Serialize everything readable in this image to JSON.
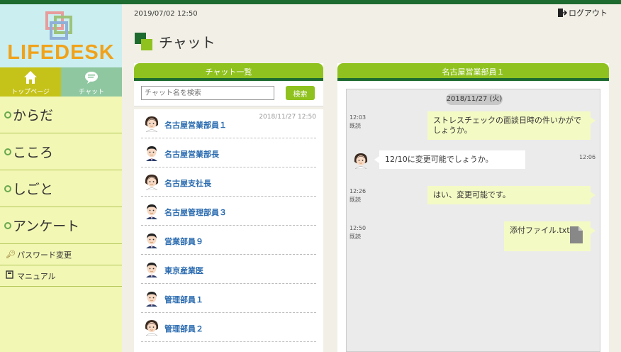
{
  "app": {
    "logo_text": "LIFEDESK",
    "datetime": "2019/07/02 12:50",
    "logout_label": "ログアウト",
    "page_title": "チャット",
    "colors": {
      "accent_green": "#8fc21e",
      "dark_green": "#1e6b30",
      "sidebar_bg": "#f2f7b4",
      "logo_bg": "#cbeef0",
      "link_blue": "#2a6bb0"
    }
  },
  "sidebar": {
    "tabs": [
      {
        "label": "トップページ",
        "icon": "home-icon"
      },
      {
        "label": "チャット",
        "icon": "chat-icon"
      }
    ],
    "menu": [
      {
        "label": "からだ"
      },
      {
        "label": "こころ"
      },
      {
        "label": "しごと"
      },
      {
        "label": "アンケート"
      }
    ],
    "sub": [
      {
        "label": "パスワード変更",
        "icon": "key-icon"
      },
      {
        "label": "マニュアル",
        "icon": "book-icon"
      }
    ]
  },
  "chat_list": {
    "header": "チャット一覧",
    "search_placeholder": "チャット名を検索",
    "search_button": "検索",
    "items": [
      {
        "name": "名古屋営業部員１",
        "timestamp": "2018/11/27 12:50",
        "avatar": "female"
      },
      {
        "name": "名古屋営業部長",
        "timestamp": "",
        "avatar": "male"
      },
      {
        "name": "名古屋支社長",
        "timestamp": "",
        "avatar": "female"
      },
      {
        "name": "名古屋管理部員３",
        "timestamp": "",
        "avatar": "male"
      },
      {
        "name": "営業部員９",
        "timestamp": "",
        "avatar": "male"
      },
      {
        "name": "東京産業医",
        "timestamp": "",
        "avatar": "male"
      },
      {
        "name": "管理部員１",
        "timestamp": "",
        "avatar": "male"
      },
      {
        "name": "管理部員２",
        "timestamp": "",
        "avatar": "female"
      }
    ]
  },
  "chat_detail": {
    "header": "名古屋営業部員１",
    "date_chip": "2018/11/27 (火)",
    "messages": [
      {
        "side": "me",
        "time": "12:03",
        "status": "既読",
        "text": "ストレスチェックの面談日時の件いかがでしょうか。"
      },
      {
        "side": "them",
        "time": "12:06",
        "text": "12/10に変更可能でしょうか。"
      },
      {
        "side": "me",
        "time": "12:26",
        "status": "既読",
        "text": "はい、変更可能です。"
      },
      {
        "side": "me",
        "time": "12:50",
        "status": "既読",
        "text": "添付ファイル.txt",
        "icon": "file-icon"
      }
    ]
  }
}
